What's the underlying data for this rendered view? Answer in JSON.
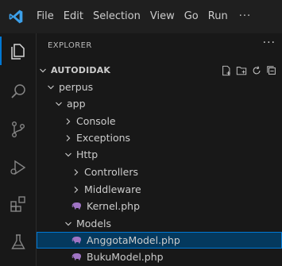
{
  "menu": [
    "File",
    "Edit",
    "Selection",
    "View",
    "Go",
    "Run",
    "···"
  ],
  "explorer": {
    "header": "EXPLORER",
    "more": "···"
  },
  "tree": [
    {
      "label": "AUTODIDAK",
      "depth": 0,
      "type": "root",
      "expanded": true
    },
    {
      "label": "perpus",
      "depth": 1,
      "type": "folder",
      "expanded": true
    },
    {
      "label": "app",
      "depth": 2,
      "type": "folder",
      "expanded": true
    },
    {
      "label": "Console",
      "depth": 3,
      "type": "folder",
      "expanded": false
    },
    {
      "label": "Exceptions",
      "depth": 3,
      "type": "folder",
      "expanded": false
    },
    {
      "label": "Http",
      "depth": 3,
      "type": "folder",
      "expanded": true
    },
    {
      "label": "Controllers",
      "depth": 4,
      "type": "folder",
      "expanded": false
    },
    {
      "label": "Middleware",
      "depth": 4,
      "type": "folder",
      "expanded": false
    },
    {
      "label": "Kernel.php",
      "depth": 4,
      "type": "php"
    },
    {
      "label": "Models",
      "depth": 3,
      "type": "folder",
      "expanded": true
    },
    {
      "label": "AnggotaModel.php",
      "depth": 4,
      "type": "php",
      "selected": true
    },
    {
      "label": "BukuModel.php",
      "depth": 4,
      "type": "php"
    }
  ],
  "colors": {
    "accent": "#0078d4",
    "php_icon": "#a074c4",
    "selection": "#04395e"
  }
}
